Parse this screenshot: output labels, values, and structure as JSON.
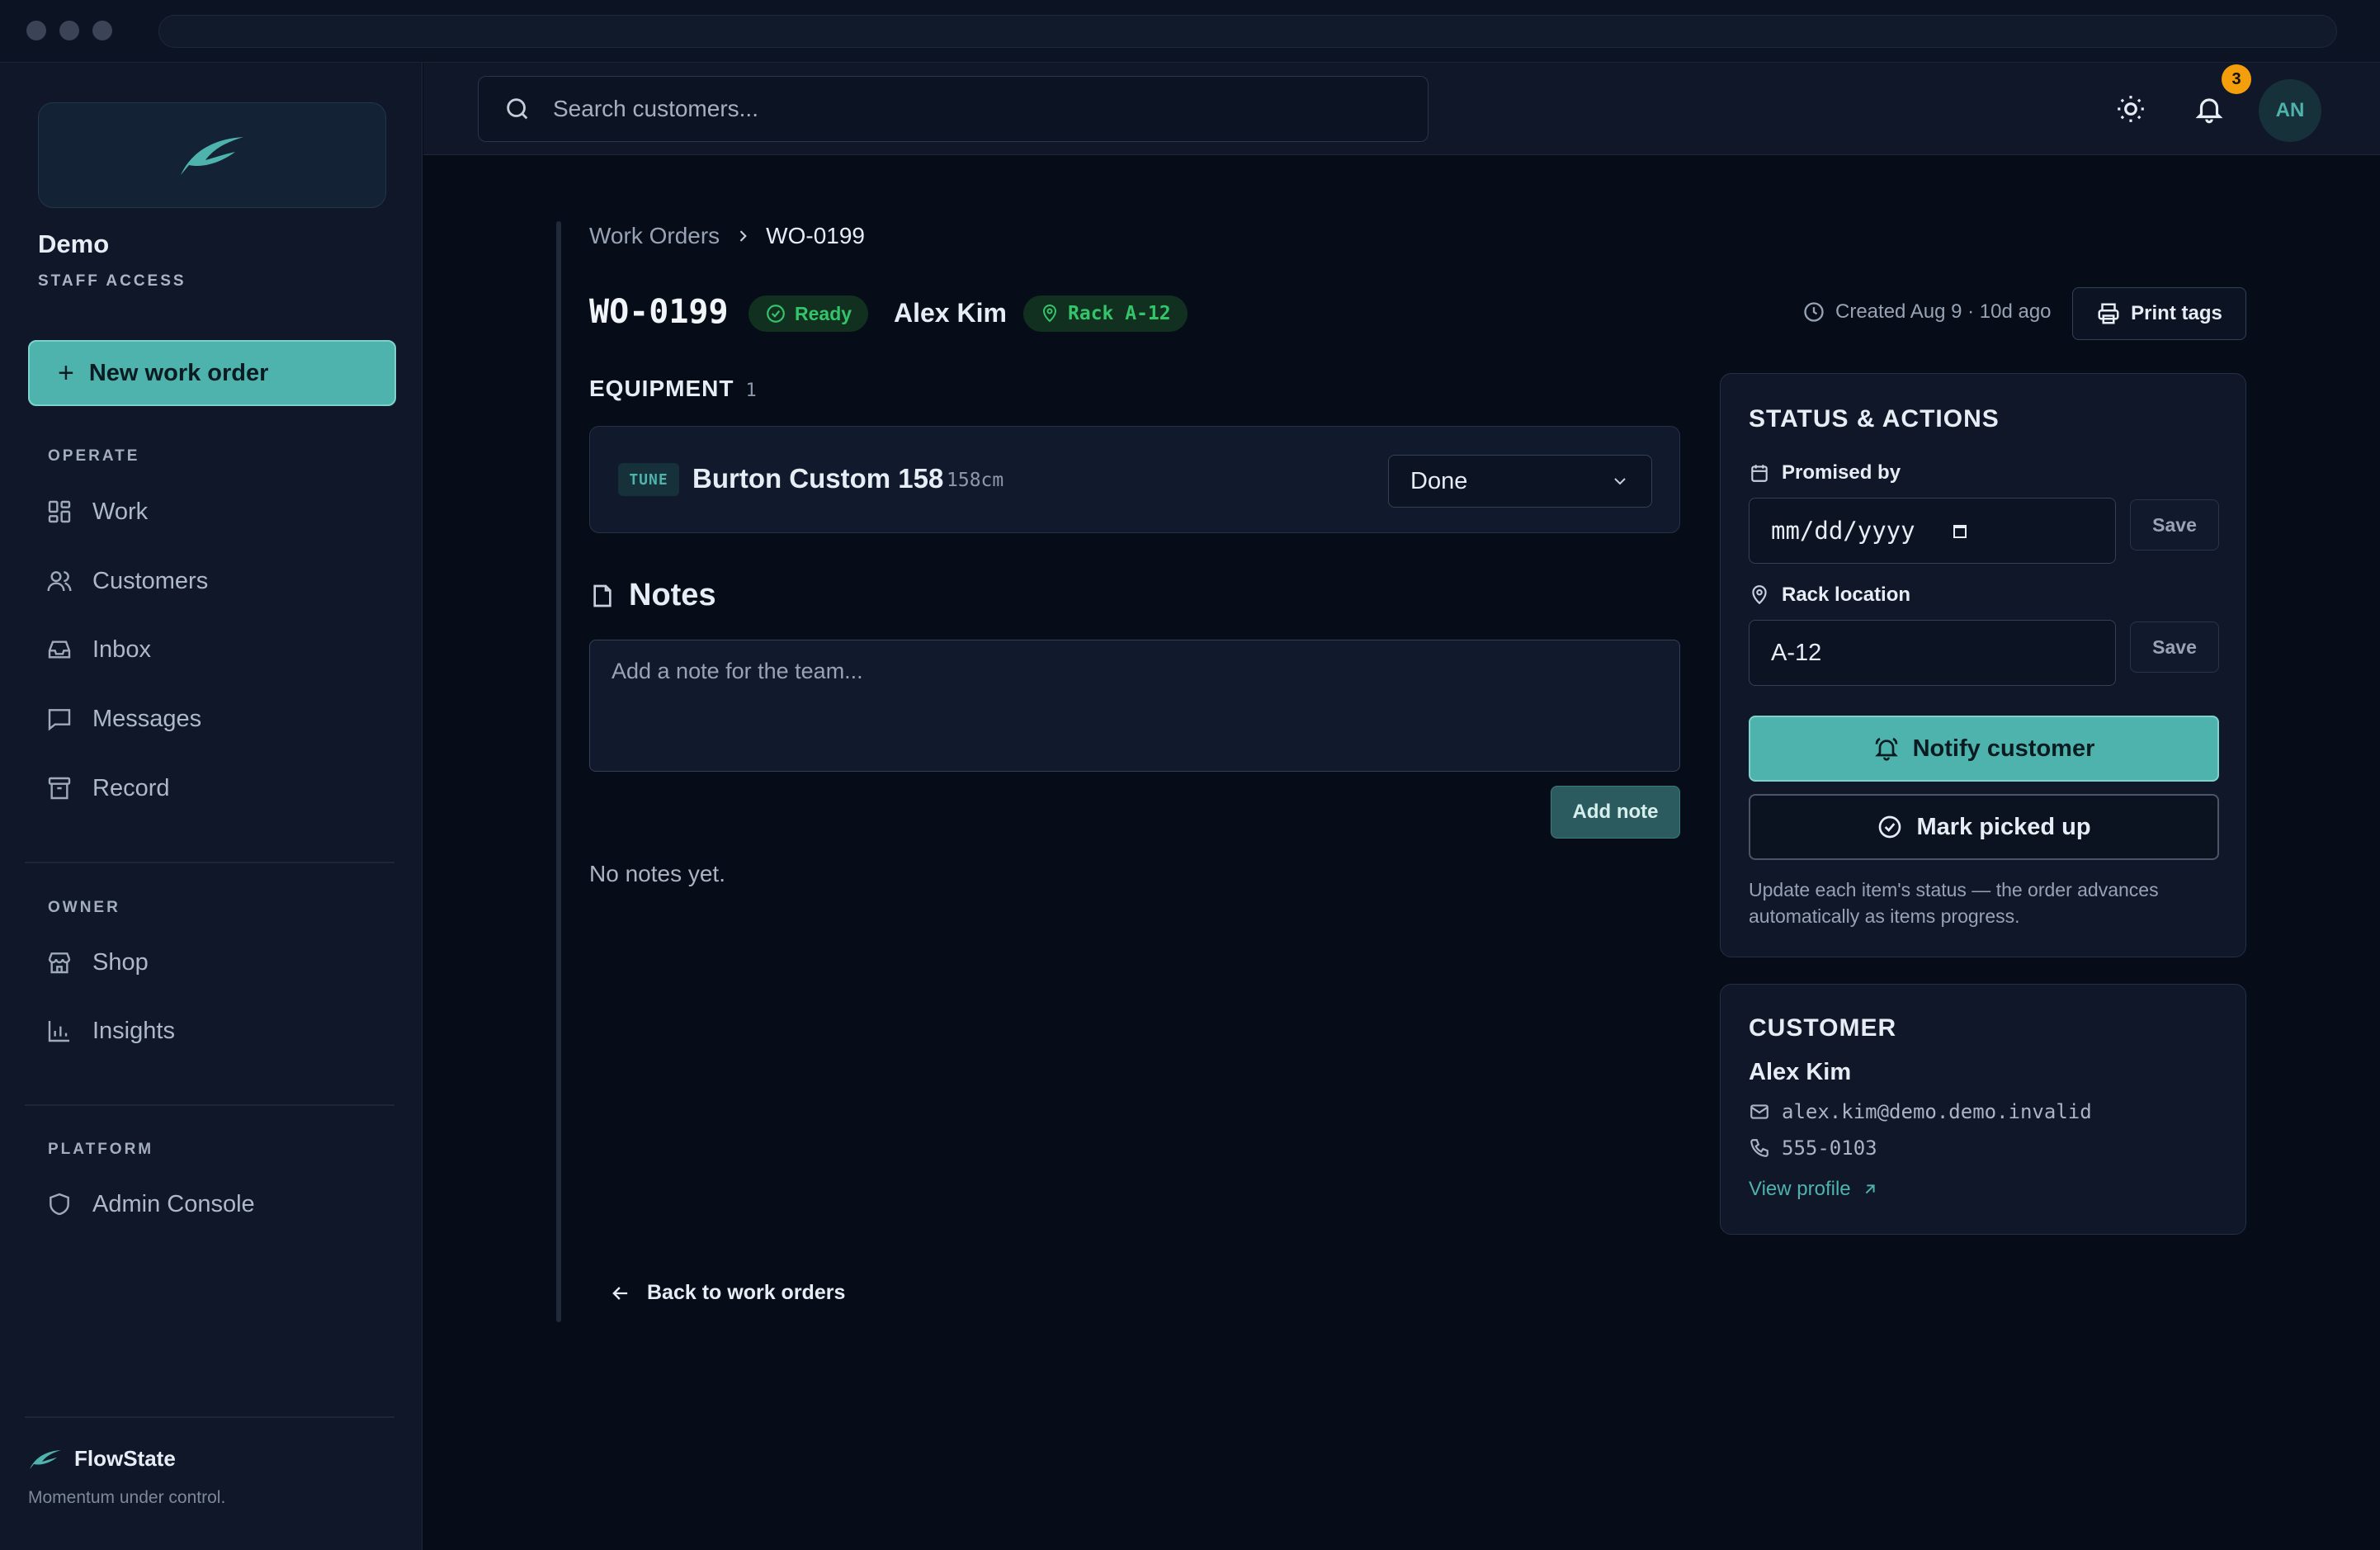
{
  "sidebar": {
    "brand_name": "Demo",
    "brand_sub": "STAFF ACCESS",
    "new_button": "New work order",
    "sections": {
      "operate": "OPERATE",
      "owner": "OWNER",
      "platform": "PLATFORM"
    },
    "items": {
      "work": "Work",
      "customers": "Customers",
      "inbox": "Inbox",
      "messages": "Messages",
      "record": "Record",
      "shop": "Shop",
      "insights": "Insights",
      "admin": "Admin Console"
    },
    "footer_brand": "FlowState",
    "footer_tagline": "Momentum under control."
  },
  "topbar": {
    "search_placeholder": "Search customers...",
    "notification_count": "3",
    "avatar_initials": "AN"
  },
  "breadcrumb": {
    "parent": "Work Orders",
    "current": "WO-0199"
  },
  "order": {
    "id": "WO-0199",
    "status": "Ready",
    "customer": "Alex Kim",
    "rack": "Rack A-12",
    "created": "Created Aug 9 · 10d ago",
    "print_label": "Print tags"
  },
  "equipment": {
    "title": "EQUIPMENT",
    "count": "1",
    "item": {
      "tag": "TUNE",
      "name": "Burton Custom 158",
      "size": "158cm",
      "status": "Done"
    }
  },
  "notes": {
    "title": "Notes",
    "placeholder": "Add a note for the team...",
    "add_label": "Add note",
    "empty": "No notes yet."
  },
  "back_label": "Back to work orders",
  "status_panel": {
    "title": "STATUS & ACTIONS",
    "promised_label": "Promised by",
    "promised_value": "mm/dd/yyyy",
    "rack_label": "Rack location",
    "rack_value": "A-12",
    "save_label": "Save",
    "notify_label": "Notify customer",
    "picked_label": "Mark picked up",
    "hint": "Update each item's status — the order advances automatically as items progress."
  },
  "customer_panel": {
    "title": "CUSTOMER",
    "name": "Alex Kim",
    "email": "alex.kim@demo.demo.invalid",
    "phone": "555-0103",
    "link": "View profile"
  }
}
